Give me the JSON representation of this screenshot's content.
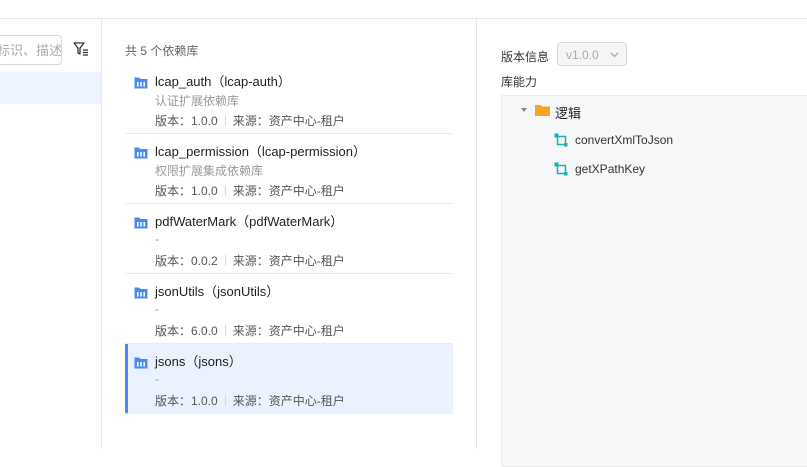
{
  "search": {
    "placeholder": "标识、描述"
  },
  "middle": {
    "count_text": "共 5 个依赖库",
    "libraries": [
      {
        "name": "lcap_auth（lcap-auth）",
        "description": "认证扩展依赖库",
        "version": "版本：1.0.0",
        "source": "来源：资产中心-租户",
        "selected": false
      },
      {
        "name": "lcap_permission（lcap-permission）",
        "description": "权限扩展集成依赖库",
        "version": "版本：1.0.0",
        "source": "来源：资产中心-租户",
        "selected": false
      },
      {
        "name": "pdfWaterMark（pdfWaterMark）",
        "description": "-",
        "version": "版本：0.0.2",
        "source": "来源：资产中心-租户",
        "selected": false
      },
      {
        "name": "jsonUtils（jsonUtils）",
        "description": "-",
        "version": "版本：6.0.0",
        "source": "来源：资产中心-租户",
        "selected": false
      },
      {
        "name": "jsons（jsons）",
        "description": "-",
        "version": "版本：1.0.0",
        "source": "来源：资产中心-租户",
        "selected": true
      }
    ]
  },
  "right": {
    "version_label": "版本信息",
    "version_value": "v1.0.0",
    "capability_label": "库能力",
    "tree": {
      "folder": "逻辑",
      "items": [
        "convertXmlToJson",
        "getXPathKey"
      ]
    }
  },
  "colors": {
    "accent": "#4b89f5",
    "folder": "#f5a623",
    "function_icon": "#19b3b7",
    "selected_bg": "#eaf2ff"
  }
}
